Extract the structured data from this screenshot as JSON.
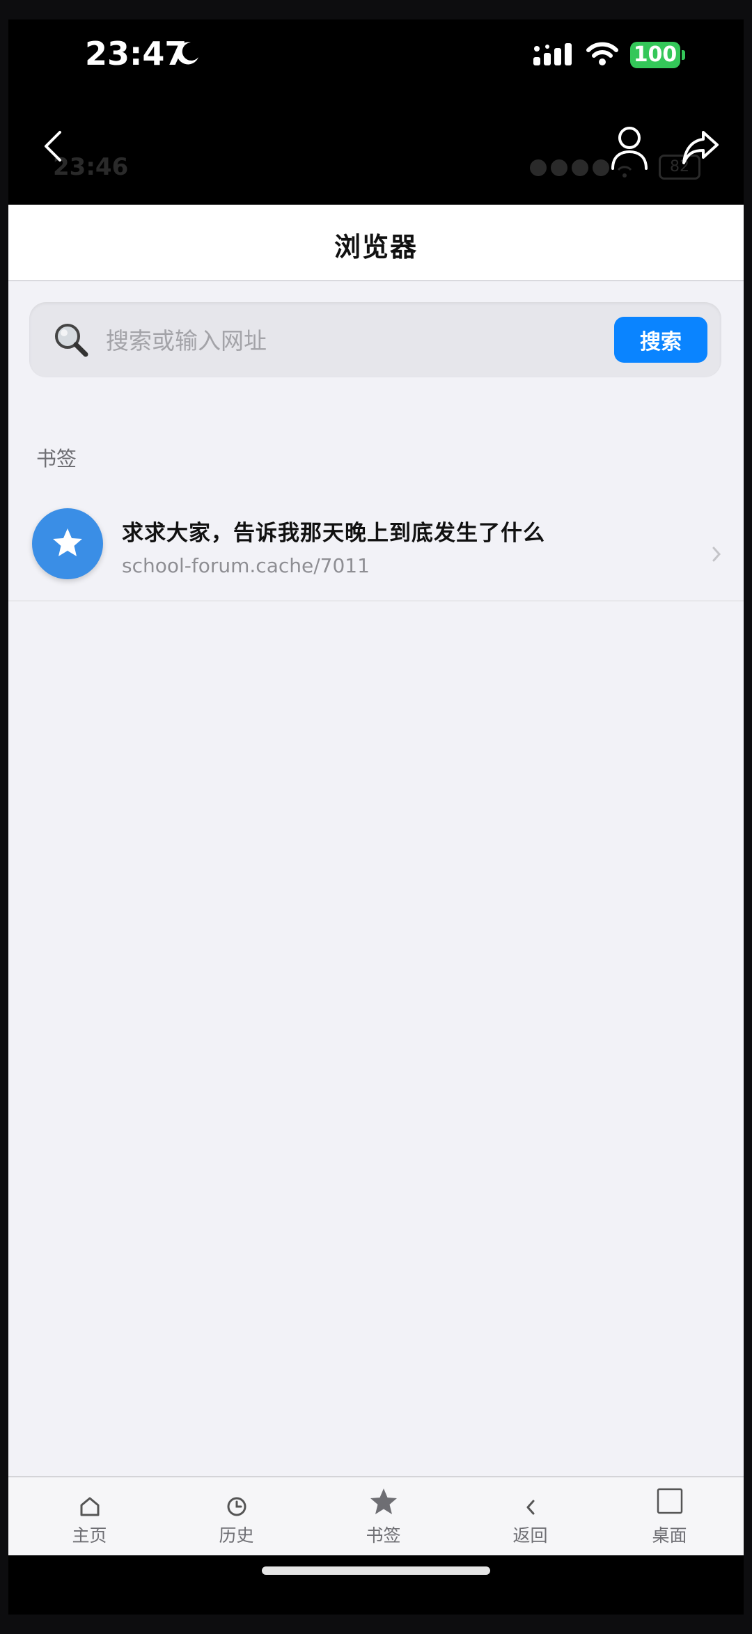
{
  "status_bar": {
    "time": "23:47",
    "battery": "100",
    "ghost_time": "23:46",
    "ghost_battery": "82"
  },
  "browser": {
    "title": "浏览器",
    "search": {
      "placeholder": "搜索或输入网址",
      "button_label": "搜索"
    },
    "section_label": "书签",
    "bookmarks": [
      {
        "title": "求求大家，告诉我那天晚上到底发生了什么",
        "url": "school-forum.cache/7011"
      }
    ]
  },
  "tab_bar": {
    "items": [
      {
        "label": "主页",
        "icon": "home-icon"
      },
      {
        "label": "历史",
        "icon": "clock-icon"
      },
      {
        "label": "书签",
        "icon": "star-icon"
      },
      {
        "label": "返回",
        "icon": "chevron-left-icon"
      },
      {
        "label": "桌面",
        "icon": "square-icon"
      }
    ]
  },
  "colors": {
    "accent": "#0a84ff",
    "bookmark_avatar": "#3a8ee6",
    "battery": "#34c759",
    "background": "#f2f2f7"
  }
}
